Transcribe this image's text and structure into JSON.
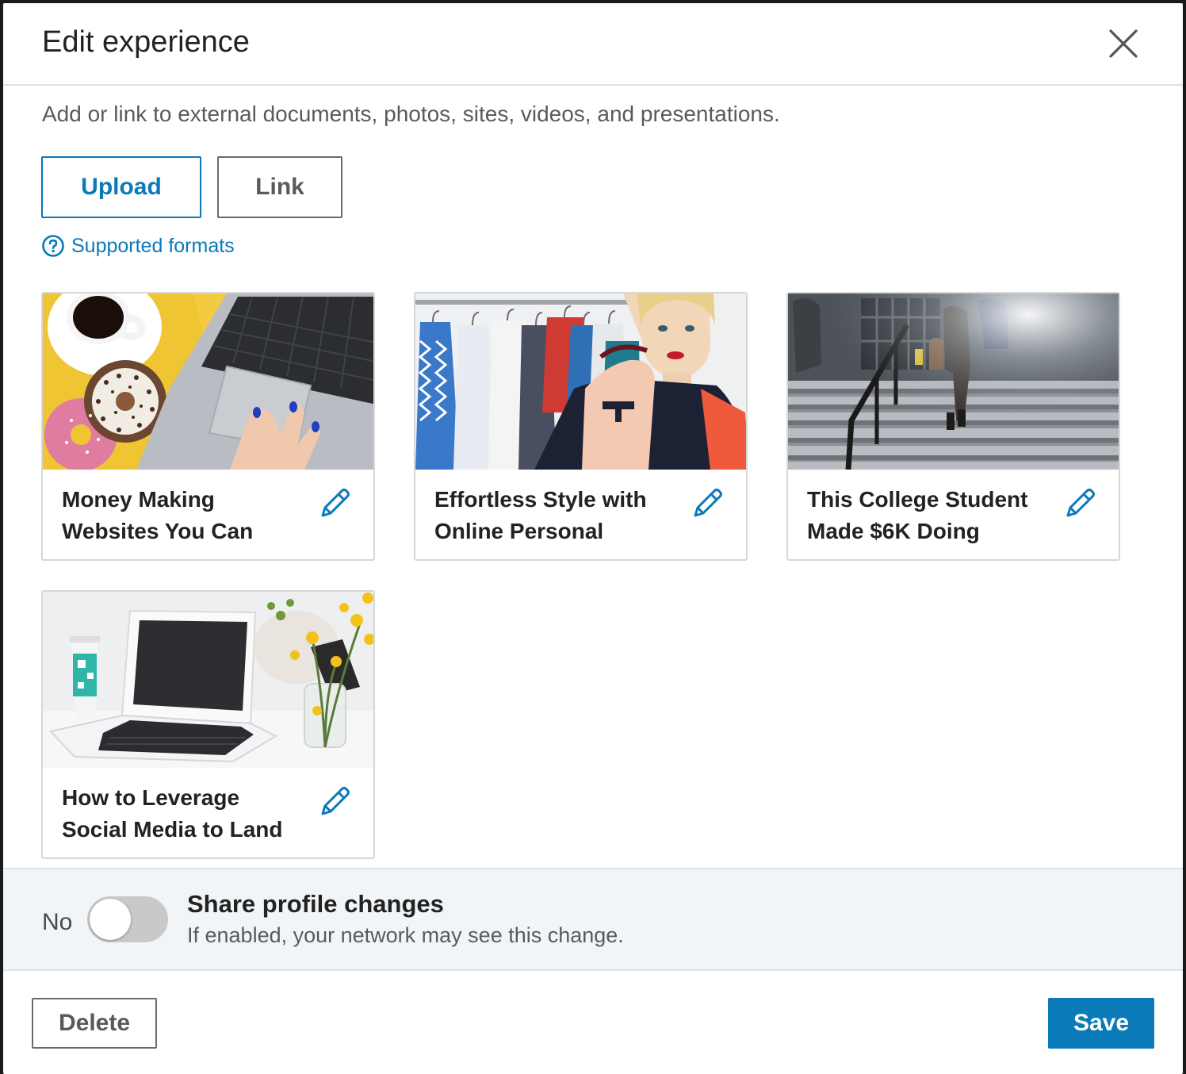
{
  "modal": {
    "title": "Edit experience",
    "close_icon": "close-icon",
    "subtitle": "Add or link to external documents, photos, sites, videos, and presentations."
  },
  "actions": {
    "upload_label": "Upload",
    "link_label": "Link",
    "formats_label": "Supported formats",
    "formats_icon": "question-circle-icon"
  },
  "media": [
    {
      "title_line1": "Money Making",
      "title_line2": "Websites You Can",
      "thumb": "laptop-donuts-coffee",
      "edit_icon": "pencil-icon"
    },
    {
      "title_line1": "Effortless Style with",
      "title_line2": "Online Personal",
      "thumb": "woman-clothes-rack",
      "edit_icon": "pencil-icon"
    },
    {
      "title_line1": "This College Student",
      "title_line2": "Made $6K Doing",
      "thumb": "campus-stairs",
      "edit_icon": "pencil-icon"
    },
    {
      "title_line1": "How to Leverage",
      "title_line2": "Social Media to Land",
      "thumb": "white-laptop-flowers",
      "edit_icon": "pencil-icon"
    }
  ],
  "share": {
    "toggle_state_label": "No",
    "title": "Share profile changes",
    "description": "If enabled, your network may see this change."
  },
  "footer": {
    "delete_label": "Delete",
    "save_label": "Save"
  },
  "colors": {
    "accent": "#0a7ab8",
    "share_bg": "#f2f5f7",
    "toggle_off": "#c9c9c9"
  }
}
